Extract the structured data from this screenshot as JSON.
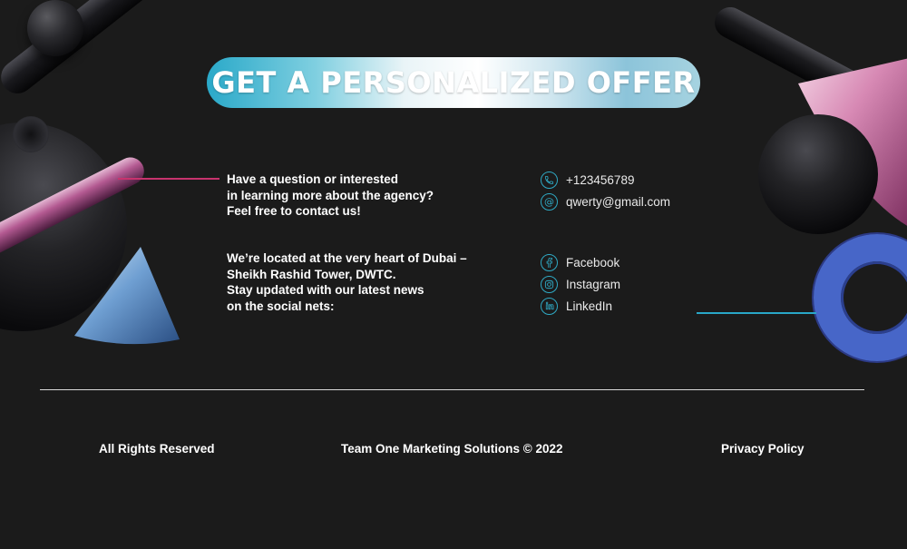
{
  "headline": "GET A PERSONALIZED OFFER",
  "about": {
    "lines": [
      "Have a question or interested",
      "in learning more about the agency?",
      "Feel free to contact us!"
    ]
  },
  "location": {
    "lines": [
      "We’re located at the very heart of Dubai –",
      "Sheikh Rashid Tower, DWTC.",
      "Stay updated with our latest news",
      "on the social nets:"
    ]
  },
  "contacts": [
    {
      "icon": "phone-icon",
      "label": "+123456789"
    },
    {
      "icon": "email-icon",
      "label": "qwerty@gmail.com"
    }
  ],
  "socials": [
    {
      "icon": "facebook-icon",
      "label": "Facebook"
    },
    {
      "icon": "instagram-icon",
      "label": "Instagram"
    },
    {
      "icon": "linkedin-icon",
      "label": "LinkedIn"
    }
  ],
  "footer": {
    "rights": "All Rights Reserved",
    "copyright": "Team One Marketing Solutions © 2022",
    "privacy": "Privacy Policy"
  },
  "colors": {
    "background": "#1b1b1b",
    "accent_pink": "#c8336e",
    "accent_teal": "#2fa9c4"
  }
}
